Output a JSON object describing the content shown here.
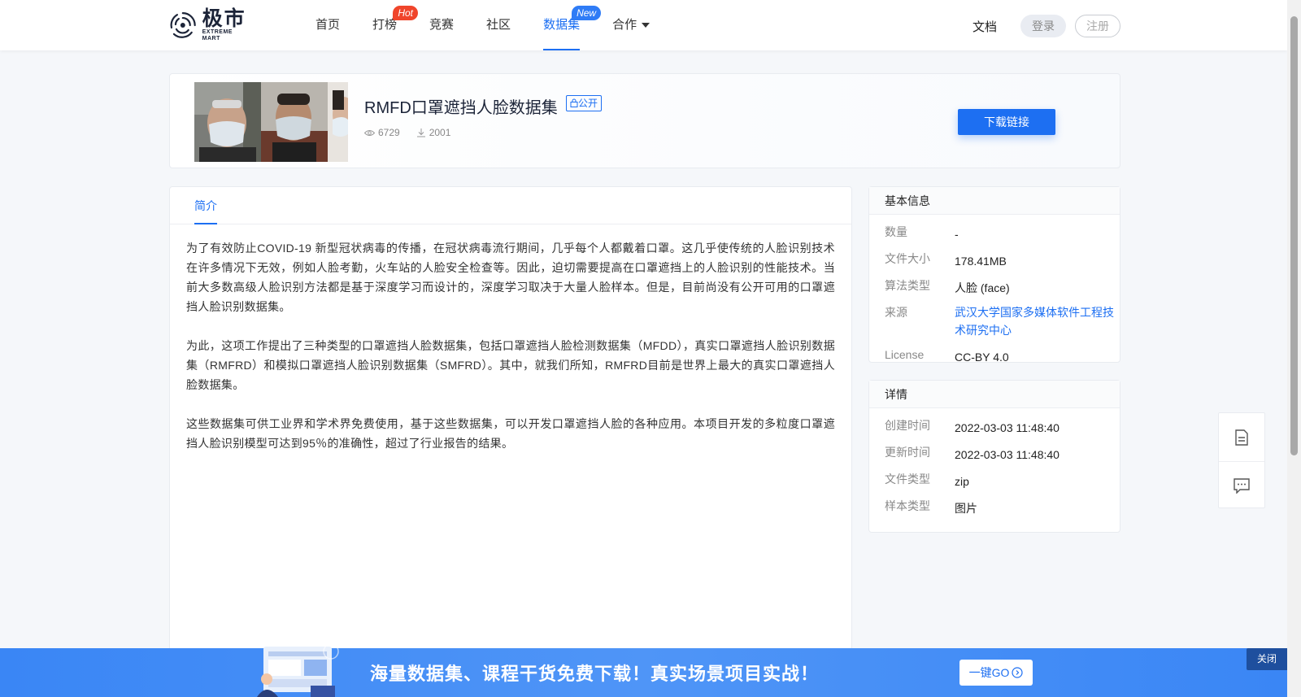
{
  "header": {
    "logo_cn": "极市",
    "logo_en": "EXTREME MART",
    "nav": [
      {
        "label": "首页"
      },
      {
        "label": "打榜",
        "badge": "Hot"
      },
      {
        "label": "竞赛"
      },
      {
        "label": "社区"
      },
      {
        "label": "数据集",
        "badge": "New",
        "active": true
      },
      {
        "label": "合作"
      }
    ],
    "docs": "文档",
    "login": "登录",
    "register": "注册"
  },
  "dataset": {
    "title": "RMFD口罩遮挡人脸数据集",
    "visibility": "公开",
    "views": "6729",
    "downloads": "2001",
    "download_button": "下载链接"
  },
  "intro": {
    "tab": "简介",
    "paragraphs": [
      "为了有效防止COVID-19 新型冠状病毒的传播，在冠状病毒流行期间，几乎每个人都戴着口罩。这几乎使传统的人脸识别技术在许多情况下无效，例如人脸考勤，火车站的人脸安全检查等。因此，迫切需要提高在口罩遮挡上的人脸识别的性能技术。当前大多数高级人脸识别方法都是基于深度学习而设计的，深度学习取决于大量人脸样本。但是，目前尚没有公开可用的口罩遮挡人脸识别数据集。",
      "为此，这项工作提出了三种类型的口罩遮挡人脸数据集，包括口罩遮挡人脸检测数据集（MFDD），真实口罩遮挡人脸识别数据集（RMFRD）和模拟口罩遮挡人脸识别数据集（SMFRD）。其中，就我们所知，RMFRD目前是世界上最大的真实口罩遮挡人脸数据集。",
      "这些数据集可供工业界和学术界免费使用，基于这些数据集，可以开发口罩遮挡人脸的各种应用。本项目开发的多粒度口罩遮挡人脸识别模型可达到95％的准确性，超过了行业报告的结果。"
    ]
  },
  "basic_info": {
    "title": "基本信息",
    "rows": [
      {
        "key": "数量",
        "value": "-"
      },
      {
        "key": "文件大小",
        "value": "178.41MB"
      },
      {
        "key": "算法类型",
        "value": "人脸 (face)"
      },
      {
        "key": "来源",
        "value": "武汉大学国家多媒体软件工程技术研究中心"
      },
      {
        "key": "License",
        "value": "CC-BY 4.0"
      }
    ]
  },
  "details": {
    "title": "详情",
    "rows": [
      {
        "key": "创建时间",
        "value": "2022-03-03 11:48:40"
      },
      {
        "key": "更新时间",
        "value": "2022-03-03 11:48:40"
      },
      {
        "key": "文件类型",
        "value": "zip"
      },
      {
        "key": "样本类型",
        "value": "图片"
      }
    ]
  },
  "banner": {
    "text": "海量数据集、课程干货免费下载！真实场景项目实战！",
    "go_button": "一键GO",
    "close": "关闭"
  },
  "colors": {
    "accent": "#1d6ff2",
    "hot_badge": "#f0452b",
    "new_badge": "#2f7cf6",
    "banner": "#3a86f5"
  },
  "icons": [
    "logo-mark",
    "eye-icon",
    "download-icon",
    "lock-icon",
    "document-icon",
    "message-icon",
    "arrow-circle-icon",
    "caret-down-icon"
  ]
}
